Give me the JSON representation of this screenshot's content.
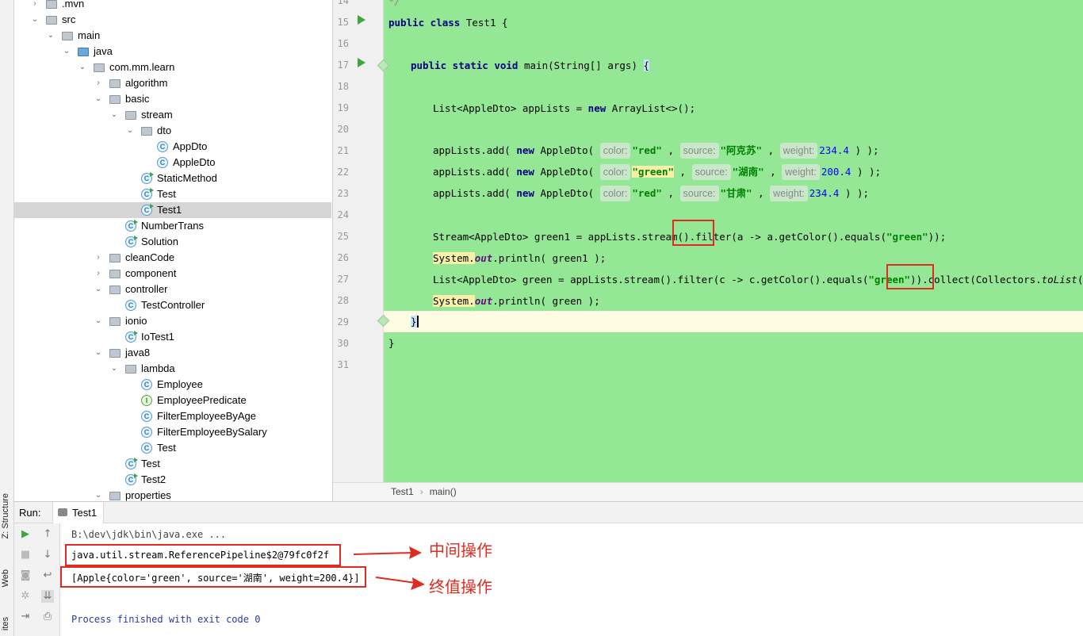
{
  "side_strip": {
    "structure": "Z: Structure",
    "web": "Web",
    "favorites": "ites"
  },
  "tree": [
    {
      "label": ".mvn",
      "depth": 0,
      "icon": "folder-icon",
      "arrow": "closed"
    },
    {
      "label": "src",
      "depth": 0,
      "icon": "folder-icon",
      "arrow": "open"
    },
    {
      "label": "main",
      "depth": 1,
      "icon": "folder-icon",
      "arrow": "open"
    },
    {
      "label": "java",
      "depth": 2,
      "icon": "source-folder-icon",
      "arrow": "open"
    },
    {
      "label": "com.mm.learn",
      "depth": 3,
      "icon": "package-icon",
      "arrow": "open"
    },
    {
      "label": "algorithm",
      "depth": 4,
      "icon": "package-icon",
      "arrow": "closed"
    },
    {
      "label": "basic",
      "depth": 4,
      "icon": "package-icon",
      "arrow": "open"
    },
    {
      "label": "stream",
      "depth": 5,
      "icon": "package-icon",
      "arrow": "open"
    },
    {
      "label": "dto",
      "depth": 6,
      "icon": "package-icon",
      "arrow": "open"
    },
    {
      "label": "AppDto",
      "depth": 7,
      "icon": "class-icon",
      "arrow": ""
    },
    {
      "label": "AppleDto",
      "depth": 7,
      "icon": "class-icon",
      "arrow": ""
    },
    {
      "label": "StaticMethod",
      "depth": 6,
      "icon": "runnable-class-icon",
      "arrow": ""
    },
    {
      "label": "Test",
      "depth": 6,
      "icon": "runnable-class-icon",
      "arrow": ""
    },
    {
      "label": "Test1",
      "depth": 6,
      "icon": "runnable-class-icon",
      "arrow": "",
      "selected": true
    },
    {
      "label": "NumberTrans",
      "depth": 5,
      "icon": "runnable-class-icon",
      "arrow": ""
    },
    {
      "label": "Solution",
      "depth": 5,
      "icon": "runnable-class-icon",
      "arrow": ""
    },
    {
      "label": "cleanCode",
      "depth": 4,
      "icon": "package-icon",
      "arrow": "closed"
    },
    {
      "label": "component",
      "depth": 4,
      "icon": "package-icon",
      "arrow": "closed"
    },
    {
      "label": "controller",
      "depth": 4,
      "icon": "package-icon",
      "arrow": "open"
    },
    {
      "label": "TestController",
      "depth": 5,
      "icon": "class-icon",
      "arrow": ""
    },
    {
      "label": "ionio",
      "depth": 4,
      "icon": "package-icon",
      "arrow": "open"
    },
    {
      "label": "IoTest1",
      "depth": 5,
      "icon": "runnable-class-icon",
      "arrow": ""
    },
    {
      "label": "java8",
      "depth": 4,
      "icon": "package-icon",
      "arrow": "open"
    },
    {
      "label": "lambda",
      "depth": 5,
      "icon": "package-icon",
      "arrow": "open"
    },
    {
      "label": "Employee",
      "depth": 6,
      "icon": "class-icon",
      "arrow": ""
    },
    {
      "label": "EmployeePredicate",
      "depth": 6,
      "icon": "interface-icon",
      "arrow": ""
    },
    {
      "label": "FilterEmployeeByAge",
      "depth": 6,
      "icon": "class-icon",
      "arrow": ""
    },
    {
      "label": "FilterEmployeeBySalary",
      "depth": 6,
      "icon": "class-icon",
      "arrow": ""
    },
    {
      "label": "Test",
      "depth": 6,
      "icon": "class-icon",
      "arrow": ""
    },
    {
      "label": "Test",
      "depth": 5,
      "icon": "runnable-class-icon",
      "arrow": ""
    },
    {
      "label": "Test2",
      "depth": 5,
      "icon": "runnable-class-icon",
      "arrow": ""
    },
    {
      "label": "properties",
      "depth": 4,
      "icon": "package-icon",
      "arrow": "open"
    }
  ],
  "editor": {
    "line_numbers": [
      "14",
      "15",
      "16",
      "17",
      "18",
      "19",
      "20",
      "21",
      "22",
      "23",
      "24",
      "25",
      "26",
      "27",
      "28",
      "29",
      "30",
      "31"
    ],
    "line14": "*/",
    "class_kw": "public class",
    "class_name": " Test1 {",
    "main_kw": "public static void",
    "main_sig": " main(String[] args) ",
    "main_brace": "{",
    "l19_a": "List<AppleDto> appLists = ",
    "l19_new": "new",
    "l19_b": " ArrayList<>();",
    "add_prefix": "appLists.add( ",
    "new_kw": "new",
    "apple_ctor": " AppleDto( ",
    "hint_color": "color:",
    "hint_source": "source:",
    "hint_weight": "weight:",
    "comma": " , ",
    "add_suffix": " ) );",
    "rows": [
      {
        "color": "\"red\"",
        "source": "\"阿克苏\"",
        "weight": "234.4"
      },
      {
        "color": "\"green\"",
        "source": "\"湖南\"",
        "weight": "200.4"
      },
      {
        "color": "\"red\"",
        "source": "\"甘肃\"",
        "weight": "234.4"
      }
    ],
    "l25_a": "Stream<AppleDto> green1 = appLists.stream()",
    "l25_filter": ".filter",
    "l25_b": "(a -> a.getColor().equals(",
    "l25_str": "\"green\"",
    "l25_c": "));",
    "sys": "System.",
    "out": "out",
    "l26_b": ".println( green1 );",
    "l27_a": "List<AppleDto> green = appLists.stream().filter(c -> c.getColor().equals(",
    "l27_str": "\"green\"",
    "l27_b": "))",
    "l27_collect": ".collect",
    "l27_c": "(Collectors.",
    "l27_tolist": "toList",
    "l27_d": "());",
    "l28_b": ".println( green );",
    "close_method": "}",
    "close_class": "}"
  },
  "breadcrumb": [
    "Test1",
    "main()"
  ],
  "run": {
    "label": "Run:",
    "tab": "Test1",
    "console": [
      "B:\\dev\\jdk\\bin\\java.exe ...",
      "java.util.stream.ReferencePipeline$2@79fc0f2f",
      "[Apple{color='green', source='湖南', weight=200.4}]",
      "Process finished with exit code 0"
    ]
  },
  "annotations": {
    "intermediate": "中间操作",
    "terminal": "终值操作"
  },
  "colors": {
    "code_bg": "#94e795",
    "highlight_box": "#e02b20",
    "keyword": "#000080",
    "string": "#008000"
  }
}
